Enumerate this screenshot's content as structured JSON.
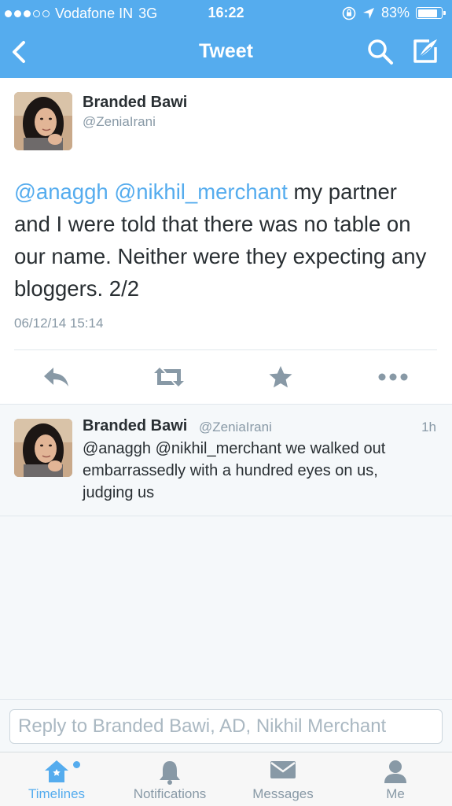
{
  "status_bar": {
    "carrier": "Vodafone IN",
    "network": "3G",
    "time": "16:22",
    "battery": "83%",
    "battery_level": 0.83
  },
  "nav": {
    "title": "Tweet"
  },
  "main_tweet": {
    "author_name": "Branded Bawi",
    "author_handle": "@ZeniaIrani",
    "mention_1": "@anaggh",
    "mention_2": "@nikhil_merchant",
    "text": " my partner and I were told that there was no table on our name. Neither were they expecting any bloggers. 2/2",
    "timestamp": "06/12/14 15:14"
  },
  "reply_tweet": {
    "author_name": "Branded Bawi",
    "author_handle": "@ZeniaIrani",
    "time_ago": "1h",
    "text": "@anaggh @nikhil_merchant we walked out embarrassedly with a hundred eyes on us, judging us"
  },
  "reply_box": {
    "placeholder": "Reply to Branded Bawi, AD, Nikhil Merchant"
  },
  "tabs": [
    {
      "label": "Timelines",
      "icon": "home-icon",
      "active": true
    },
    {
      "label": "Notifications",
      "icon": "bell-icon",
      "active": false
    },
    {
      "label": "Messages",
      "icon": "envelope-icon",
      "active": false
    },
    {
      "label": "Me",
      "icon": "person-icon",
      "active": false
    }
  ],
  "colors": {
    "brand": "#55acee",
    "text": "#292f33",
    "muted": "#8899a6",
    "icon_gray": "#8899a6"
  }
}
